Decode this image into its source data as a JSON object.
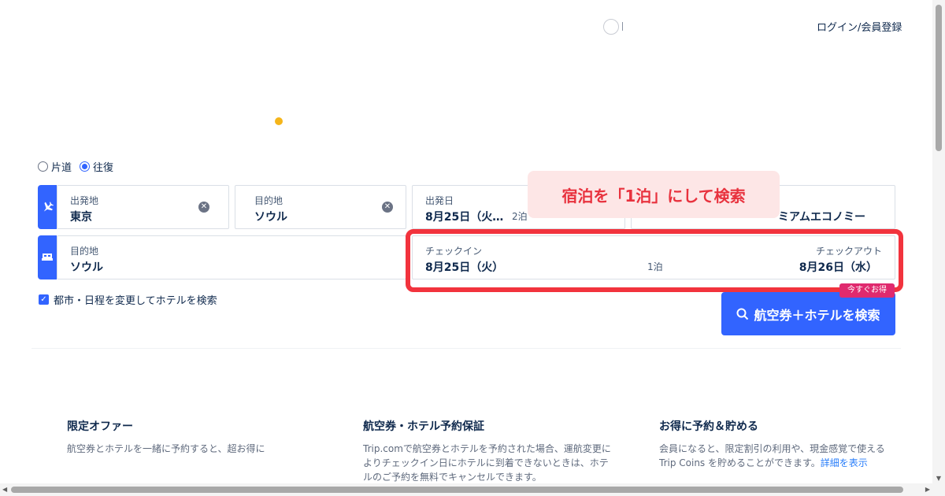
{
  "header": {
    "login_label": "ログイン/会員登録"
  },
  "trip_type": {
    "one_way": "片道",
    "round_trip": "往復",
    "selected": "往復"
  },
  "flight": {
    "origin_label": "出発地",
    "origin_value": "東京",
    "dest_label": "目的地",
    "dest_value": "ソウル",
    "depart_label": "出発日",
    "depart_value": "8月25日（火…",
    "nights": "2泊",
    "cabin_value": "ミアムエコノミー"
  },
  "hotel": {
    "dest_label": "目的地",
    "dest_value": "ソウル",
    "checkin_label": "チェックイン",
    "checkin_value": "8月25日（火）",
    "nights": "1泊",
    "checkout_label": "チェックアウト",
    "checkout_value": "8月26日（水）"
  },
  "annotation": {
    "callout_text": "宿泊を「1泊」にして検索"
  },
  "promo_tag": "今すぐお得",
  "hotel_option": {
    "label": "都市・日程を変更してホテルを検索",
    "checked": true
  },
  "search_button": {
    "label": "航空券＋ホテルを検索"
  },
  "info": [
    {
      "title": "限定オファー",
      "text": "航空券とホテルを一緒に予約すると、超お得に"
    },
    {
      "title": "航空券・ホテル予約保証",
      "text": "Trip.comで航空券とホテルを予約された場合、運航変更によりチェックイン日にホテルに到着できないときは、ホテルのご予約を無料でキャンセルできます。"
    },
    {
      "title": "お得に予約＆貯める",
      "text": "会員になると、限定割引の利用や、現金感覚で使えるTrip Coins を貯めることができます。",
      "link": "詳細を表示"
    }
  ],
  "colors": {
    "accent": "#3264ff",
    "annotation_red": "#f2333d",
    "promo_pink": "#e02a6e"
  }
}
